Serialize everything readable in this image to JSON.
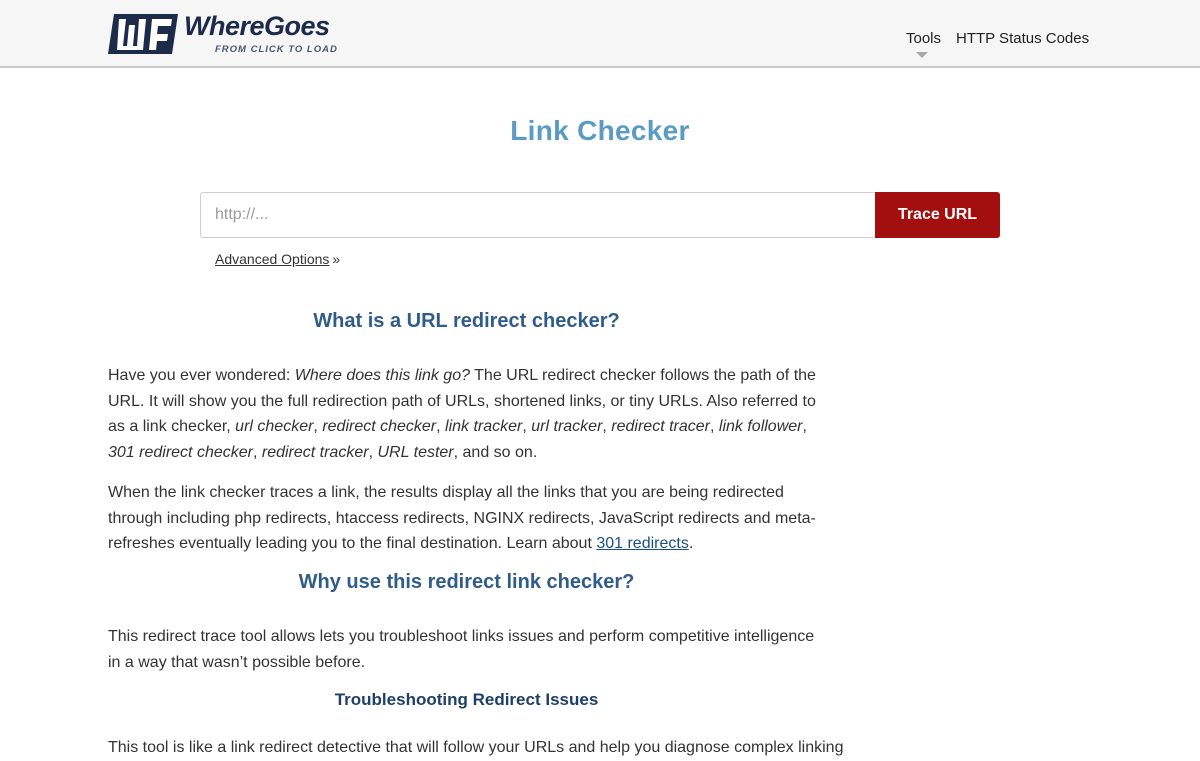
{
  "header": {
    "logo": {
      "word_first": "Where",
      "word_second": "Goes",
      "tagline": "FROM CLICK TO LOAD"
    },
    "nav": [
      {
        "label": "Tools"
      },
      {
        "label": "HTTP Status Codes"
      }
    ]
  },
  "main": {
    "title": "Link Checker",
    "form": {
      "placeholder": "http://...",
      "button_label": "Trace URL",
      "advanced_label": "Advanced Options",
      "advanced_suffix": "»"
    },
    "sections": {
      "what_heading": "What is a URL redirect checker?",
      "p1": {
        "a": "Have you ever wondered: ",
        "b": "Where does this link go?",
        "c": " The URL redirect checker follows the path of the URL. It will show you the full redirection path of URLs, shortened links, or tiny URLs. Also referred to as a link checker, ",
        "terms": [
          "url checker",
          "redirect checker",
          "link tracker",
          "url tracker",
          "redirect tracer",
          "link follower",
          "301 redirect checker",
          "redirect tracker",
          "URL tester"
        ],
        "sep": ", ",
        "end": ", and so on."
      },
      "p2": {
        "a": "When the link checker traces a link, the results display all the links that you are being redirected through including php redirects, htaccess redirects, NGINX redirects, JavaScript redirects and meta-refreshes eventually leading you to the final destination. Learn about ",
        "link": "301 redirects",
        "end": "."
      },
      "why_heading": "Why use this redirect link checker?",
      "p3": "This redirect trace tool allows lets you troubleshoot links issues and perform competitive intelligence in a way that wasn’t possible before.",
      "trouble_heading": "Troubleshooting Redirect Issues",
      "p4": "This tool is like a link redirect detective that will follow your URLs and help you diagnose complex linking"
    }
  },
  "colors": {
    "title": "#5a9bc6",
    "heading": "#2f5c8a",
    "button": "#a30e0e",
    "logo": "#1c2b4a"
  }
}
